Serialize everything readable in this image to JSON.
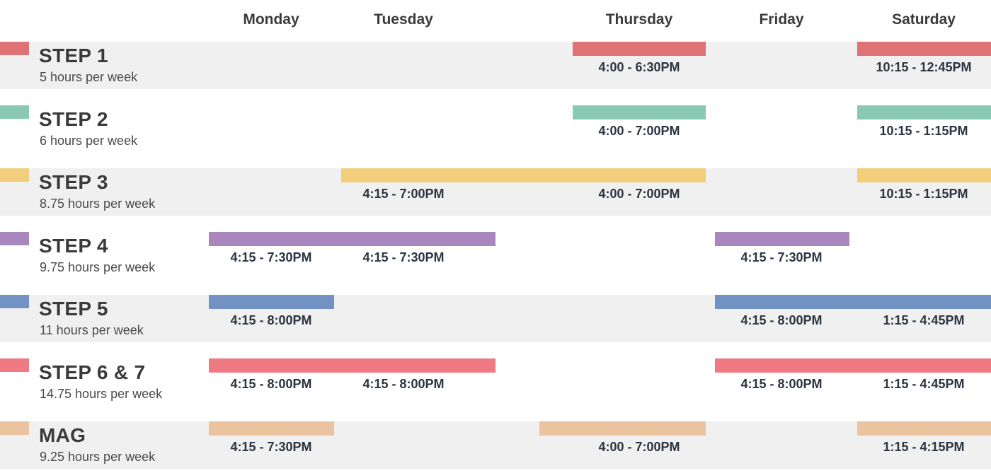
{
  "days": [
    "Monday",
    "Tuesday",
    "Thursday",
    "Friday",
    "Saturday"
  ],
  "steps": [
    {
      "title": "STEP 1",
      "subtitle": "5 hours per week",
      "color": "#df7274",
      "shaded": true,
      "sessions": [
        {
          "day": "Thursday",
          "time": "4:00 - 6:30PM"
        },
        {
          "day": "Saturday",
          "time": "10:15 -  12:45PM"
        }
      ]
    },
    {
      "title": "STEP 2",
      "subtitle": "6 hours per week",
      "color": "#89c9b3",
      "shaded": false,
      "sessions": [
        {
          "day": "Thursday",
          "time": "4:00 - 7:00PM"
        },
        {
          "day": "Saturday",
          "time": "10:15 - 1:15PM"
        }
      ]
    },
    {
      "title": "STEP 3",
      "subtitle": "8.75 hours per week",
      "color": "#f1cd7c",
      "shaded": true,
      "sessions": [
        {
          "day": "Tuesday",
          "time": "4:15 - 7:00PM"
        },
        {
          "day": "Thursday",
          "time": "4:00 - 7:00PM"
        },
        {
          "day": "Saturday",
          "time": "10:15 - 1:15PM"
        }
      ]
    },
    {
      "title": "STEP 4",
      "subtitle": "9.75 hours per week",
      "color": "#aa86be",
      "shaded": false,
      "sessions": [
        {
          "day": "Monday",
          "time": "4:15 - 7:30PM"
        },
        {
          "day": "Tuesday",
          "time": "4:15 - 7:30PM"
        },
        {
          "day": "Friday",
          "time": "4:15 - 7:30PM"
        }
      ]
    },
    {
      "title": "STEP 5",
      "subtitle": "11 hours per week",
      "color": "#7192c3",
      "shaded": true,
      "sessions": [
        {
          "day": "Monday",
          "time": "4:15 - 8:00PM"
        },
        {
          "day": "Friday",
          "time": "4:15 - 8:00PM"
        },
        {
          "day": "Saturday",
          "time": "1:15 - 4:45PM"
        }
      ]
    },
    {
      "title": "STEP 6 & 7",
      "subtitle": "14.75 hours per week",
      "color": "#f07a84",
      "shaded": false,
      "sessions": [
        {
          "day": "Monday",
          "time": "4:15 - 8:00PM"
        },
        {
          "day": "Tuesday",
          "time": "4:15 - 8:00PM"
        },
        {
          "day": "Friday",
          "time": "4:15 - 8:00PM"
        },
        {
          "day": "Saturday",
          "time": "1:15 - 4:45PM"
        }
      ]
    },
    {
      "title": "MAG",
      "subtitle": "9.25 hours per week",
      "color": "#ebc39f",
      "shaded": true,
      "sessions": [
        {
          "day": "Monday",
          "time": "4:15 - 7:30PM"
        },
        {
          "day": "Thursday",
          "time": "4:00 - 7:00PM"
        },
        {
          "day": "Saturday",
          "time": "1:15 - 4:15PM"
        }
      ]
    }
  ]
}
